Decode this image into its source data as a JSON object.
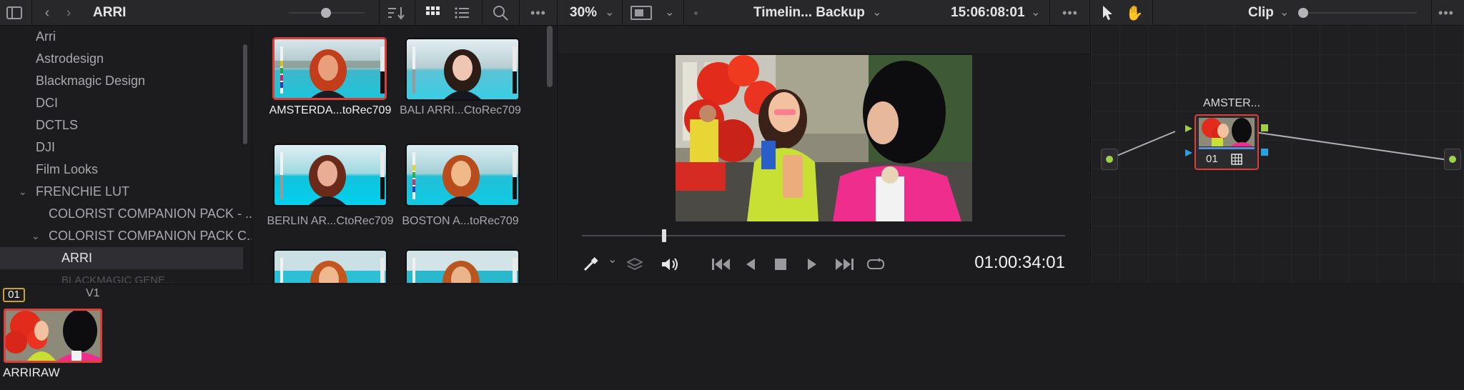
{
  "topbar": {
    "folder_title": "ARRI",
    "zoom": "30%",
    "timeline_name": "Timelin... Backup",
    "timecode": "15:06:08:01",
    "node_mode": "Clip"
  },
  "tree": {
    "items": [
      {
        "label": "Arri"
      },
      {
        "label": "Astrodesign"
      },
      {
        "label": "Blackmagic Design"
      },
      {
        "label": "DCI"
      },
      {
        "label": "DCTLS"
      },
      {
        "label": "DJI"
      },
      {
        "label": "Film Looks"
      },
      {
        "label": "FRENCHIE LUT"
      },
      {
        "label": "COLORIST COMPANION PACK - ..."
      },
      {
        "label": "COLORIST COMPANION PACK C..."
      },
      {
        "label": "ARRI"
      },
      {
        "label": "BLACKMAGIC GENE..."
      }
    ]
  },
  "luts": [
    {
      "label": "AMSTERDA...toRec709"
    },
    {
      "label": "BALI ARRI...CtoRec709"
    },
    {
      "label": "BERLIN AR...CtoRec709"
    },
    {
      "label": "BOSTON A...toRec709"
    }
  ],
  "viewer": {
    "timecode": "01:00:34:01",
    "playhead_fraction": 0.17
  },
  "node": {
    "label": "AMSTER...",
    "number": "01"
  },
  "timeline": {
    "clip_number": "01",
    "track": "V1",
    "clip_name": "ARRIRAW"
  },
  "colors": {
    "selection": "#d8413a",
    "badge": "#c9a32c",
    "port_green": "#9fd04a",
    "port_blue": "#29a3e0"
  }
}
